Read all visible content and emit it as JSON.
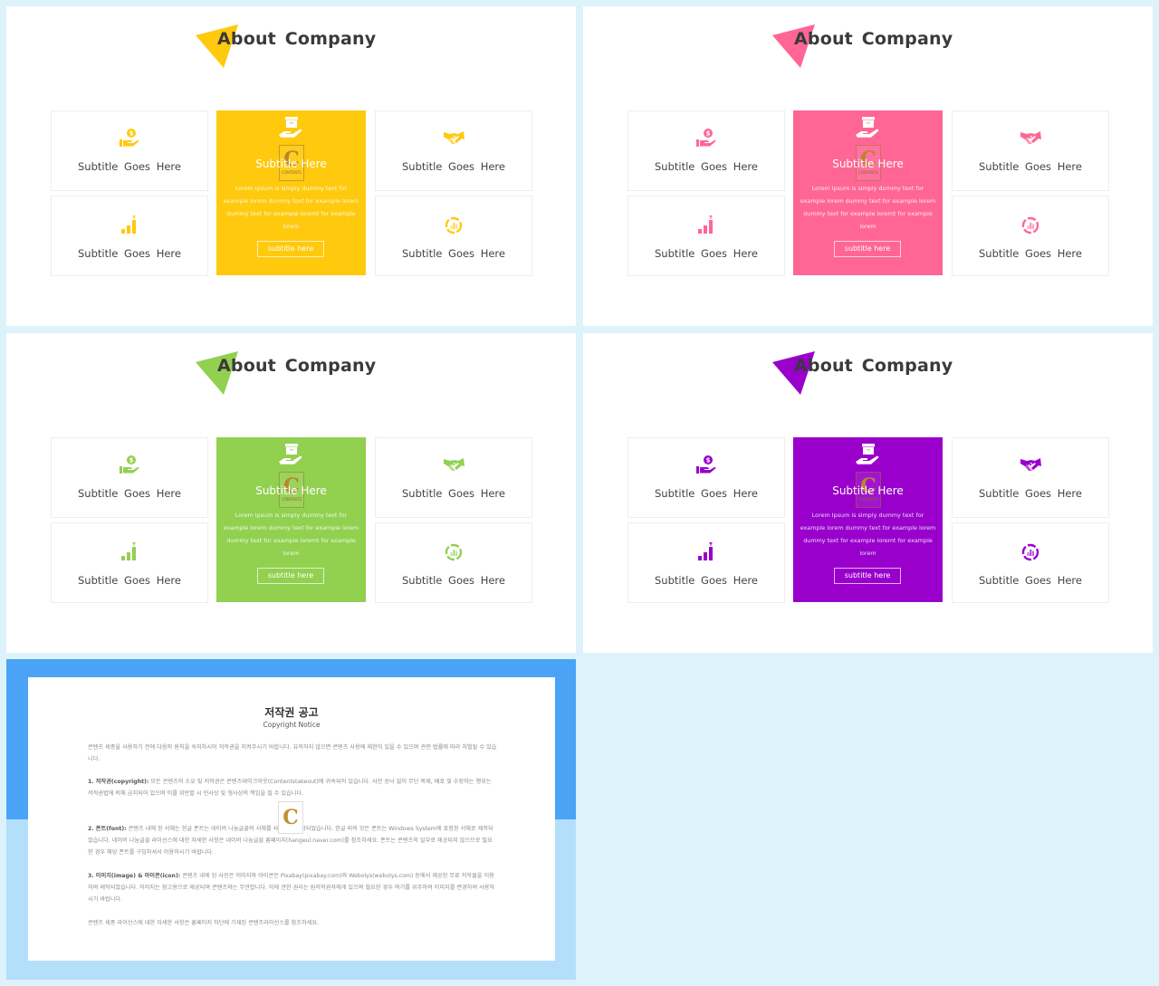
{
  "slides": [
    {
      "theme": "yellow",
      "accent": "#ffc90e",
      "title": "About Company",
      "cards": [
        {
          "icon": "hand-coin-icon",
          "label": "Subtitle  Goes Here"
        },
        {
          "icon": "bar-growth-icon",
          "label": "Subtitle  Goes Here"
        },
        {
          "icon": "handshake-icon",
          "label": "Subtitle  Goes Here"
        },
        {
          "icon": "chart-cycle-icon",
          "label": "Subtitle  Goes Here"
        }
      ],
      "feature": {
        "icon": "hand-box-icon",
        "title": "Subtitle Here",
        "description": "Lorem Ipsum is simply dummy text for example lorem dummy text for example lorem dummy text for example loremt for example lorem",
        "button": "subtitle here"
      }
    },
    {
      "theme": "pink",
      "accent": "#ff6695",
      "title": "About Company",
      "cards": [
        {
          "icon": "hand-coin-icon",
          "label": "Subtitle  Goes Here"
        },
        {
          "icon": "bar-growth-icon",
          "label": "Subtitle  Goes Here"
        },
        {
          "icon": "handshake-icon",
          "label": "Subtitle  Goes Here"
        },
        {
          "icon": "chart-cycle-icon",
          "label": "Subtitle  Goes Here"
        }
      ],
      "feature": {
        "icon": "hand-box-icon",
        "title": "Subtitle Here",
        "description": "Lorem Ipsum is simply dummy text for example lorem dummy text for example lorem dummy text for example loremt for example lorem",
        "button": "subtitle here"
      }
    },
    {
      "theme": "green",
      "accent": "#92d050",
      "title": "About Company",
      "cards": [
        {
          "icon": "hand-coin-icon",
          "label": "Subtitle  Goes Here"
        },
        {
          "icon": "bar-growth-icon",
          "label": "Subtitle  Goes Here"
        },
        {
          "icon": "handshake-icon",
          "label": "Subtitle  Goes Here"
        },
        {
          "icon": "chart-cycle-icon",
          "label": "Subtitle  Goes Here"
        }
      ],
      "feature": {
        "icon": "hand-box-icon",
        "title": "Subtitle Here",
        "description": "Lorem Ipsum is simply dummy text for example lorem dummy text for example lorem dummy text for example loremt for example lorem",
        "button": "subtitle here"
      }
    },
    {
      "theme": "purple",
      "accent": "#9900cc",
      "title": "About Company",
      "cards": [
        {
          "icon": "hand-coin-icon",
          "label": "Subtitle  Goes Here"
        },
        {
          "icon": "bar-growth-icon",
          "label": "Subtitle  Goes Here"
        },
        {
          "icon": "handshake-icon",
          "label": "Subtitle  Goes Here"
        },
        {
          "icon": "chart-cycle-icon",
          "label": "Subtitle  Goes Here"
        }
      ],
      "feature": {
        "icon": "hand-box-icon",
        "title": "Subtitle Here",
        "description": "Lorem Ipsum is simply dummy text for example lorem dummy text for example lorem dummy text for example loremt for example lorem",
        "button": "subtitle here"
      }
    }
  ],
  "watermark": {
    "letter": "C",
    "text": "CONTENTS"
  },
  "copyright": {
    "title": "저작권 공고",
    "subtitle": "Copyright Notice",
    "colors": {
      "top": "#4aa3f5",
      "bottom": "#b4dffb"
    },
    "intro": "콘텐츠 세종을 사용하기 전에 다음의 원칙을 숙지하시어 저작권을 지켜주시기 바랍니다. 유의하지 않으면 콘텐츠 사용에 제한이 있을 수 있으며 관련 법률에 따라 처벌될 수 있습니다.",
    "sections": [
      {
        "heading": "1. 저작권(copyright):",
        "body": " 모든 콘텐츠의 소유 및 저작권은 콘텐츠테이크아웃(Contentstakeout)에 귀속되어 있습니다. 사전 승낙 없이 무단 복제, 배포 및 수정하는 행위는 저작권법에 의해 금지되어 있으며 이를 위반할 시 민사상 및 형사상의 책임을 질 수 있습니다."
      },
      {
        "heading": "2. 폰트(font):",
        "body": " 콘텐츠 내에 된 서체는 한글 폰트는 네이버 나눔글꼴의 서체를 사용하여 제작되었습니다. 한글 외의 모든 폰트는 Windows System에 포함된 서체로 제작되었습니다. 네이버 나눔글꼴 라이선스에 대한 자세한 사항은 네이버 나눔글꼴 홈페이지(hangeul.naver.com)를 참조하세요. 폰트는 콘텐츠의 일부로 제공되지 않으므로 필요한 경우 해당 폰트를 구입하셔서 이용하시기 바랍니다."
      },
      {
        "heading": "3. 이미지(image) & 아이콘(icon):",
        "body": " 콘텐츠 내에 된 사진은 이미지와 아이콘은 Pixabay(pixabay.com)와 Webolys(webolys.com) 등에서 제공한 무료 저작물을 이용하여 제작되었습니다. 이미지는 참고용으로 제공되며 콘텐츠와는 무관합니다. 이에 관한 권리는 원저작권자에게 있으며 필요한 경우 여기를 위주하여 이미지를 변경하여 사용하시기 바랍니다."
      }
    ],
    "footer": "콘텐츠 세종 라이선스에 대한 자세한 사항은 홈페이지 하단에 기재된 콘텐츠라이선스를 참조하세요."
  }
}
